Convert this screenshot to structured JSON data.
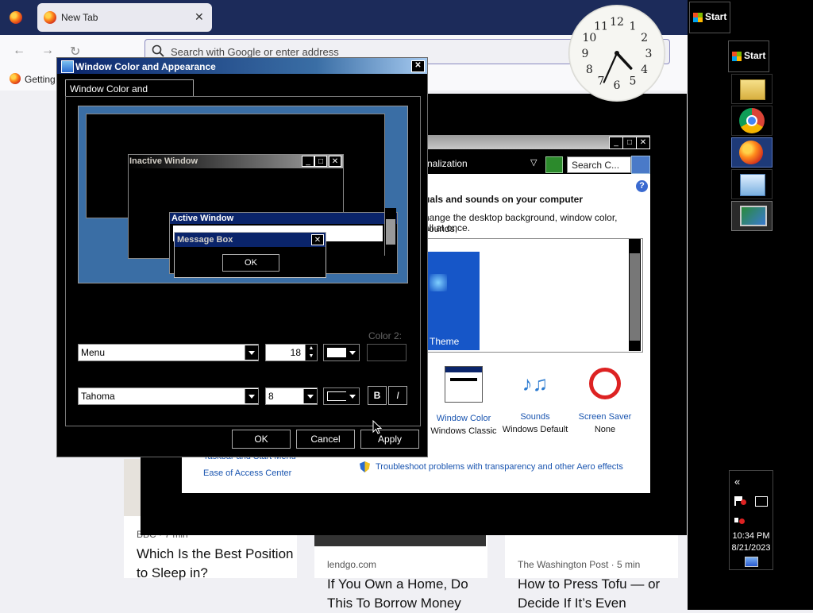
{
  "browser": {
    "tab_title": "New Tab",
    "tab_close": "✕",
    "url_placeholder": "Search with Google or enter address",
    "bookmark": "Getting"
  },
  "cards": [
    {
      "source": "BBC · 7 min",
      "title": "Which Is the Best Position to Sleep in?"
    },
    {
      "source": "lendgo.com",
      "title": "If You Own a Home, Do This To Borrow Money"
    },
    {
      "source": "The Washington Post · 5 min",
      "title": "How to Press Tofu — or Decide If It’s Even"
    }
  ],
  "taskbar": {
    "start_label": "Start",
    "start2_label": "Start",
    "tray_chevron": "«",
    "time": "10:34 PM",
    "date": "8/21/2023",
    "apps": [
      "explorer-icon",
      "chrome-icon",
      "firefox-icon",
      "control-panel-icon",
      "display-icon"
    ]
  },
  "clock": {
    "numbers": [
      "12",
      "1",
      "2",
      "3",
      "4",
      "5",
      "6",
      "7",
      "8",
      "9",
      "10",
      "11"
    ],
    "hour": 4,
    "minute": 34
  },
  "personalization": {
    "address_text": "nalization",
    "search_placeholder": "Search C...",
    "heading": "uals and sounds on your computer",
    "desc_line1": "hange the desktop background, window color, sounds,",
    "desc_line2": "all at once.",
    "theme_label": "Theme",
    "items": [
      {
        "label": "Window Color",
        "sub": "Windows Classic"
      },
      {
        "label": "Sounds",
        "sub": "Windows Default"
      },
      {
        "label": "Screen Saver",
        "sub": "None"
      }
    ],
    "link_taskbar": "Taskbar and Start Menu",
    "link_ease": "Ease of Access Center",
    "link_troubleshoot": "Troubleshoot problems with transparency and other Aero effects"
  },
  "dialog": {
    "title": "Window Color and Appearance",
    "tab_label": "Window Color and Appearance",
    "preview": {
      "inactive_title": "Inactive Window",
      "active_title": "Active Window",
      "msgbox_title": "Message Box",
      "msgbox_ok": "OK"
    },
    "item_value": "Menu",
    "size_value": "18",
    "color2_label": "Color 2:",
    "font_value": "Tahoma",
    "font_size_value": "8",
    "bold_label": "B",
    "italic_label": "I",
    "ok_label": "OK",
    "cancel_label": "Cancel",
    "apply_label": "Apply"
  },
  "colors": {
    "title_blue": "#0a246a",
    "desktop_blue": "#3a6ea5",
    "link_blue": "#1a55b0"
  }
}
